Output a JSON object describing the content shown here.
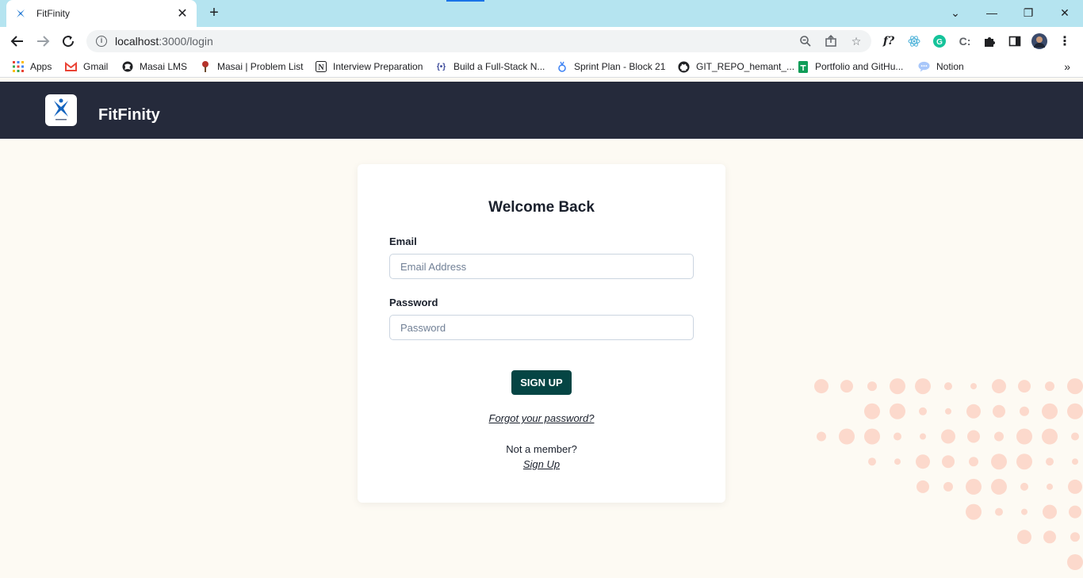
{
  "browser": {
    "tab_title": "FitFinity",
    "url_host": "localhost",
    "url_path": ":3000/login",
    "bookmarks": [
      {
        "label": "Apps",
        "icon": "apps-grid-icon"
      },
      {
        "label": "Gmail",
        "icon": "gmail-icon"
      },
      {
        "label": "Masai LMS",
        "icon": "masai-icon"
      },
      {
        "label": "Masai | Problem List",
        "icon": "masai-problem-icon"
      },
      {
        "label": "Interview Preparation",
        "icon": "notion-icon"
      },
      {
        "label": "Build a Full-Stack N...",
        "icon": "build-icon"
      },
      {
        "label": "Sprint Plan - Block 21",
        "icon": "sprint-icon"
      },
      {
        "label": "GIT_REPO_hemant_...",
        "icon": "github-icon"
      },
      {
        "label": "Portfolio and GitHu...",
        "icon": "sheets-icon"
      },
      {
        "label": "Notion",
        "icon": "chat-bubble-icon"
      }
    ]
  },
  "app": {
    "brand": "FitFinity"
  },
  "login": {
    "heading": "Welcome Back",
    "email_label": "Email",
    "email_placeholder": "Email Address",
    "password_label": "Password",
    "password_placeholder": "Password",
    "submit_label": "SIGN UP",
    "forgot_label": "Forgot your password?",
    "not_member_label": "Not a member?",
    "signup_link_label": "Sign Up"
  },
  "colors": {
    "header_bg": "#252a3b",
    "page_bg": "#fdfaf3",
    "button_bg": "#054544",
    "dots": "#fcd9cc",
    "tabstrip": "#b5e4f0"
  }
}
